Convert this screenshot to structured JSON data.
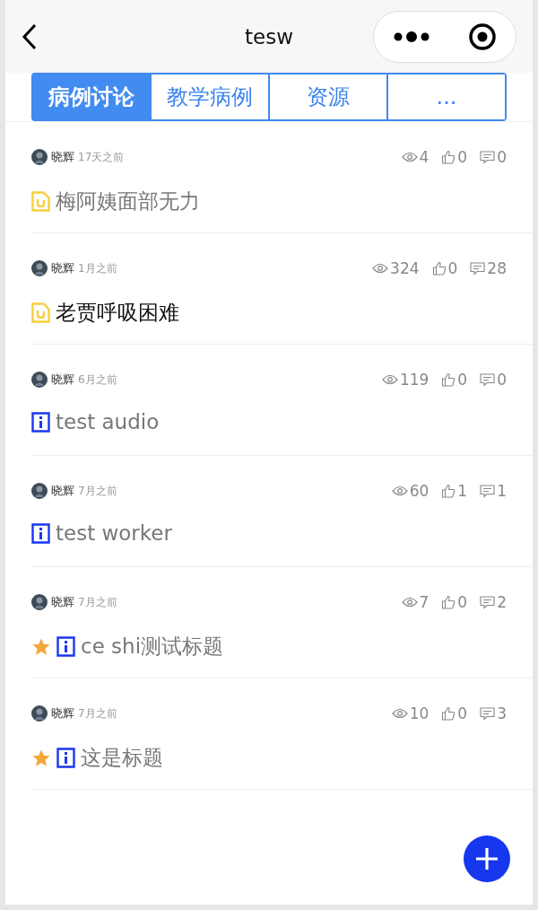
{
  "nav": {
    "title": "tesw"
  },
  "tabs": [
    {
      "label": "病例讨论",
      "selected": true
    },
    {
      "label": "教学病例",
      "selected": false
    },
    {
      "label": "资源",
      "selected": false
    },
    {
      "label": "...",
      "selected": false
    }
  ],
  "posts": [
    {
      "author": "晓辉",
      "time": "17天之前",
      "views": "4",
      "likes": "0",
      "comments": "0",
      "kind": "case",
      "starred": false,
      "read": true,
      "title": "梅阿姨面部无力"
    },
    {
      "author": "晓辉",
      "time": "1月之前",
      "views": "324",
      "likes": "0",
      "comments": "28",
      "kind": "case",
      "starred": false,
      "read": false,
      "title": "老贾呼吸困难"
    },
    {
      "author": "晓辉",
      "time": "6月之前",
      "views": "119",
      "likes": "0",
      "comments": "0",
      "kind": "doc",
      "starred": false,
      "read": true,
      "title": "test audio"
    },
    {
      "author": "晓辉",
      "time": "7月之前",
      "views": "60",
      "likes": "1",
      "comments": "1",
      "kind": "doc",
      "starred": false,
      "read": true,
      "title": "test worker"
    },
    {
      "author": "晓辉",
      "time": "7月之前",
      "views": "7",
      "likes": "0",
      "comments": "2",
      "kind": "doc",
      "starred": true,
      "read": true,
      "title": "ce shi测试标题"
    },
    {
      "author": "晓辉",
      "time": "7月之前",
      "views": "10",
      "likes": "0",
      "comments": "3",
      "kind": "doc",
      "starred": true,
      "read": true,
      "title": "这是标题"
    }
  ]
}
